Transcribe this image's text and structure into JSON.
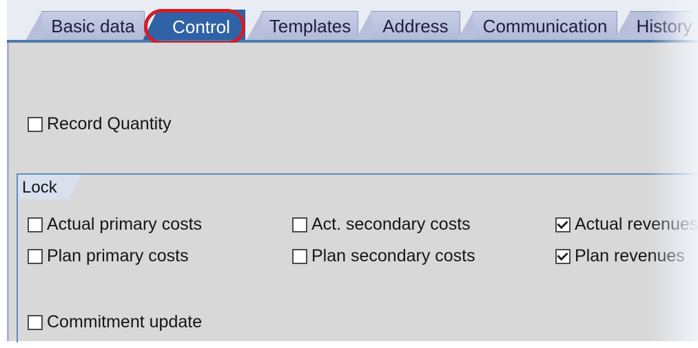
{
  "tabs": [
    {
      "label": "Basic data",
      "active": false
    },
    {
      "label": "Control",
      "active": true
    },
    {
      "label": "Templates",
      "active": false
    },
    {
      "label": "Address",
      "active": false
    },
    {
      "label": "Communication",
      "active": false
    },
    {
      "label": "History",
      "active": false
    }
  ],
  "control": {
    "record_quantity": {
      "label": "Record Quantity",
      "checked": false
    }
  },
  "lock": {
    "title": "Lock",
    "actual_primary_costs": {
      "label": "Actual primary costs",
      "checked": false
    },
    "act_secondary_costs": {
      "label": "Act. secondary costs",
      "checked": false
    },
    "actual_revenues": {
      "label": "Actual revenues",
      "checked": true
    },
    "plan_primary_costs": {
      "label": "Plan primary costs",
      "checked": false
    },
    "plan_secondary_costs": {
      "label": "Plan secondary costs",
      "checked": false
    },
    "plan_revenues": {
      "label": "Plan revenues",
      "checked": true
    },
    "commitment_update": {
      "label": "Commitment update",
      "checked": false
    }
  },
  "colors": {
    "active_tab": "#2f62a6",
    "inactive_tab": "#b8c0dc",
    "highlight_ring": "#d11d26",
    "panel_bg": "#d8d8d8",
    "group_border": "#5e8cc4"
  }
}
